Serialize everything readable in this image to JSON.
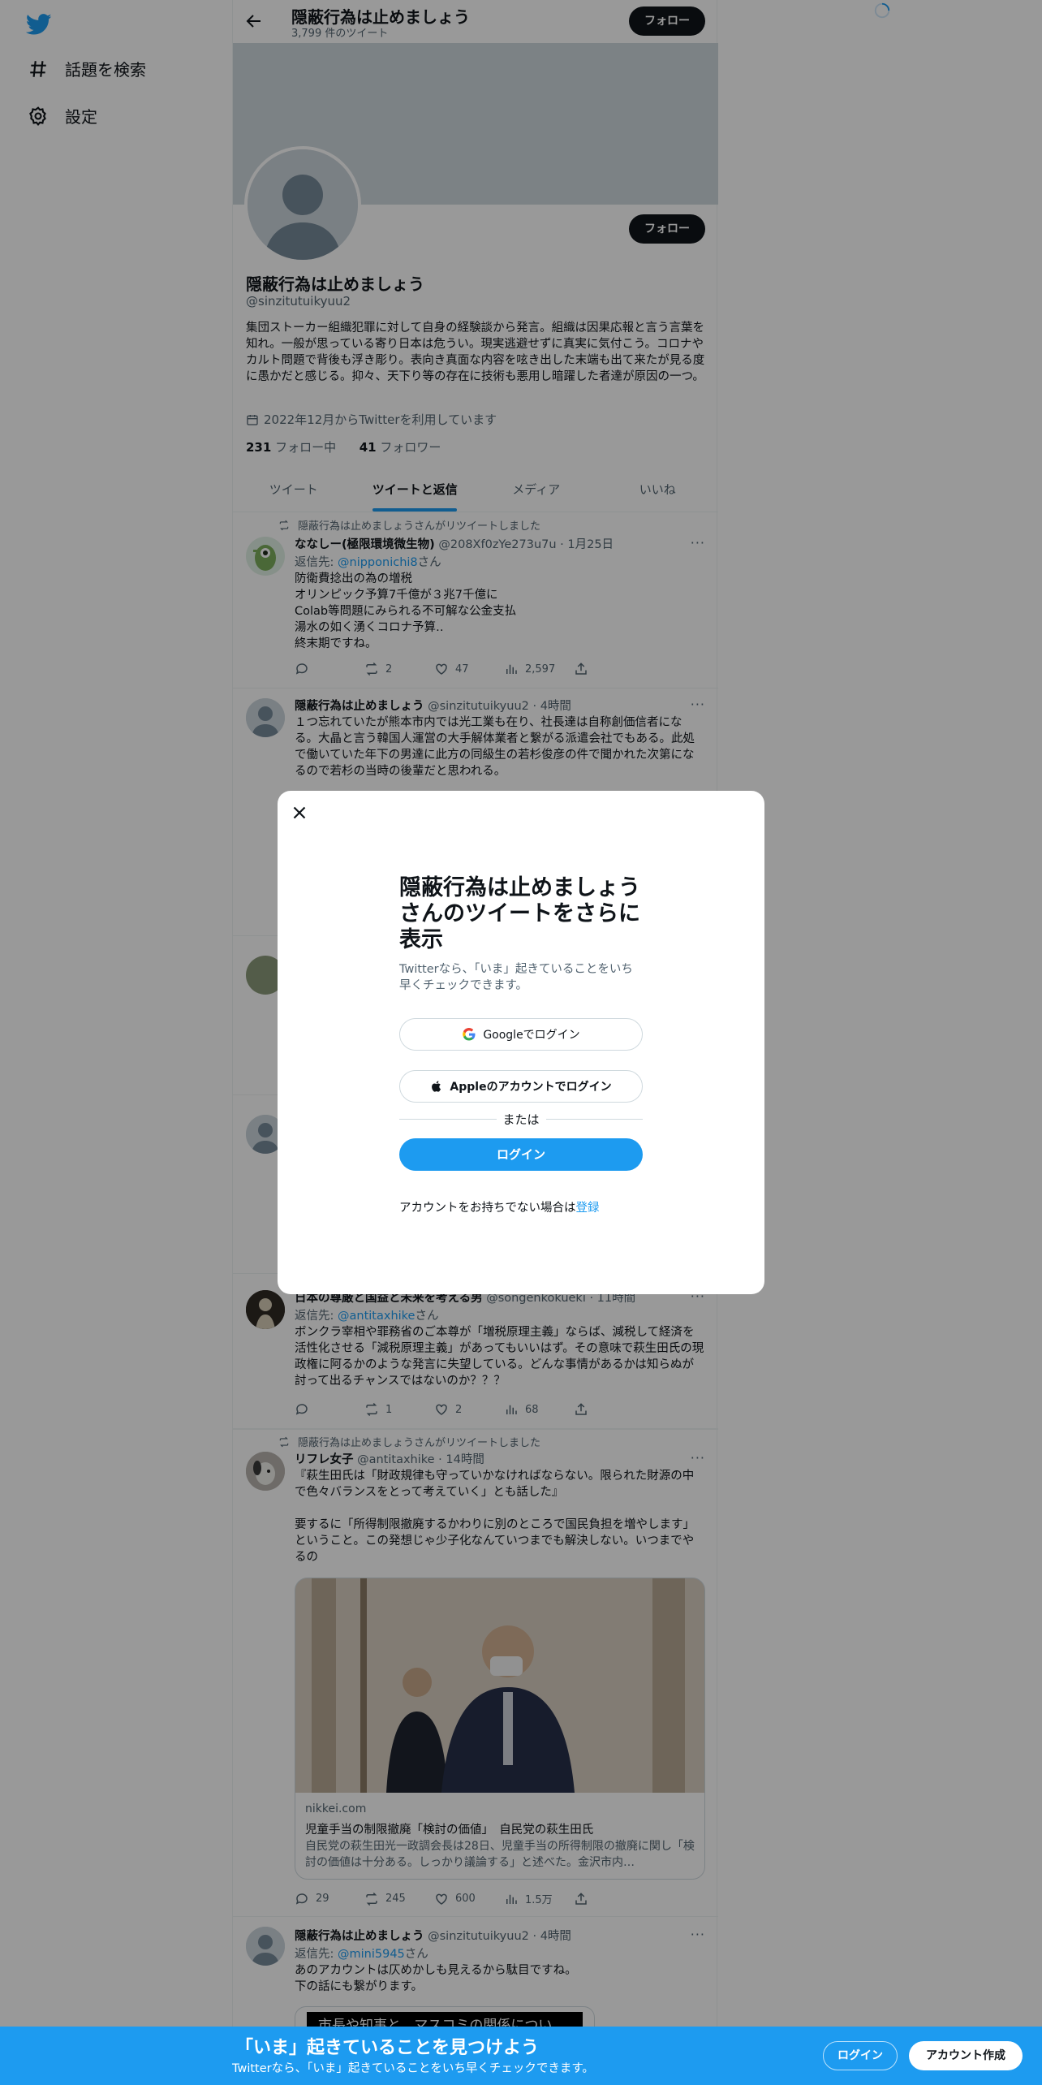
{
  "nav": {
    "explore_label": "話題を検索",
    "settings_label": "設定"
  },
  "header": {
    "title": "隠蔽行為は止めましょう",
    "tweet_count": "3,799 件のツイート",
    "follow_label": "フォロー"
  },
  "profile": {
    "name": "隠蔽行為は止めましょう",
    "handle": "@sinzitutuikyuu2",
    "follow_label": "フォロー",
    "bio": "集団ストーカー組織犯罪に対して自身の経験談から発言。組織は因果応報と言う言葉を知れ。一般が思っている寄り日本は危うい。現実逃避せずに真実に気付こう。コロナやカルト問題で背後も浮き彫り。表向き真面な内容を呟き出した末端も出て来たが見る度に愚かだと感じる。抑々、天下り等の存在に技術も悪用し暗躍した者達が原因の一つ。",
    "joined": "2022年12月からTwitterを利用しています",
    "following_count": "231",
    "following_label": "フォロー中",
    "followers_count": "41",
    "followers_label": "フォロワー"
  },
  "tabs": [
    {
      "label": "ツイート"
    },
    {
      "label": "ツイートと返信"
    },
    {
      "label": "メディア"
    },
    {
      "label": "いいね"
    }
  ],
  "tweets": [
    {
      "retweet_note": "隠蔽行為は止めましょうさんがリツイートしました",
      "name": "ななしー(極限環境微生物)",
      "meta": "@208Xf0zYe273u7u · 1月25日",
      "reply_prefix": "返信先: ",
      "reply_handle": "@nipponichi8",
      "reply_suffix": "さん",
      "text": "防衛費捻出の為の増税\nオリンピック予算7千億が３兆7千億に\nColab等問題にみられる不可解な公金支払\n湯水の如く湧くコロナ予算‥\n終末期ですね。",
      "replies": "",
      "retweets": "2",
      "likes": "47",
      "views": "2,597"
    },
    {
      "name": "隠蔽行為は止めましょう",
      "meta": "@sinzitutuikyuu2 · 4時間",
      "text": "１つ忘れていたが熊本市内では光工業も在り、社長達は自称創価信者になる。大晶と言う韓国人運営の大手解体業者と繋がる派遣会社でもある。此処で働いていた年下の男達に此方の同級生の若杉俊彦の件で聞かれた次第になるので若杉の当時の後輩だと思われる。"
    },
    {
      "name": "日本の尊厳と国益と未来を考える男",
      "meta": "@songenkokueki · 11時間",
      "reply_prefix": "返信先: ",
      "reply_handle": "@antitaxhike",
      "reply_suffix": "さん",
      "text": "ボンクラ宰相や罪務省のご本尊が「増税原理主義」ならば、減税して経済を活性化させる「減税原理主義」があってもいいはず。その意味で萩生田氏の現政権に阿るかのような発言に失望している。どんな事情があるかは知らぬが討って出るチャンスではないのか？？？",
      "replies": "",
      "retweets": "1",
      "likes": "2",
      "views": "68"
    },
    {
      "retweet_note": "隠蔽行為は止めましょうさんがリツイートしました",
      "name": "リフレ女子",
      "meta": "@antitaxhike · 14時間",
      "text": "『萩生田氏は「財政規律も守っていかなければならない。限られた財源の中で色々バランスをとって考えていく」とも話した』\n\n要するに「所得制限撤廃するかわりに別のところで国民負担を増やします」ということ。この発想じゃ少子化なんていつまでも解決しない。いつまでやるの",
      "card_domain": "nikkei.com",
      "card_title": "児童手当の制限撤廃「検討の価値」　自民党の萩生田氏",
      "card_desc": "自民党の萩生田光一政調会長は28日、児童手当の所得制限の撤廃に関し「検討の価値は十分ある。しっかり議論する」と述べた。金沢市内…",
      "replies": "29",
      "retweets": "245",
      "likes": "600",
      "views": "1.5万"
    },
    {
      "name": "隠蔽行為は止めましょう",
      "meta": "@sinzitutuikyuu2 · 4時間",
      "reply_prefix": "返信先: ",
      "reply_handle": "@mini5945",
      "reply_suffix": "さん",
      "text": "あのアカウントは仄めかしも見えるから駄目ですね。\n下の話にも繋がります。",
      "image_text": "市長や知事と、マスコミの関係につい"
    }
  ],
  "modal": {
    "title": "隠蔽行為は止めましょうさんのツイートをさらに表示",
    "subtitle": "Twitterなら、「いま」起きていることをいち早くチェックできます。",
    "google_label": "Googleでログイン",
    "apple_label": "Appleのアカウントでログイン",
    "or_label": "または",
    "login_label": "ログイン",
    "no_account_text": "アカウントをお持ちでない場合は",
    "signup_link": "登録"
  },
  "bottom_bar": {
    "title": "「いま」起きていることを見つけよう",
    "subtitle": "Twitterなら、「いま」起きていることをいち早くチェックできます。",
    "login_label": "ログイン",
    "signup_label": "アカウント作成"
  },
  "colors": {
    "accent": "#1d9bf0",
    "text": "#0f1419",
    "muted": "#536471",
    "banner": "#cfd9de"
  }
}
